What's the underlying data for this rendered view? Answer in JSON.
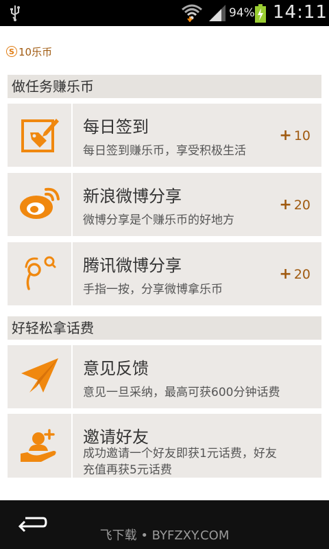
{
  "status_bar": {
    "battery_percent": "94%",
    "time": "14:11"
  },
  "balance": {
    "coin_symbol": "S",
    "text": "10乐币"
  },
  "sections": [
    {
      "title": "做任务赚乐币",
      "items": [
        {
          "title": "每日签到",
          "description": "每日签到赚乐币，享受积极生活",
          "reward": "10",
          "icon": "sign-in-edit-icon"
        },
        {
          "title": "新浪微博分享",
          "description": "微博分享是个赚乐币的好地方",
          "reward": "20",
          "icon": "sina-weibo-icon"
        },
        {
          "title": "腾讯微博分享",
          "description": "手指一按，分享微博拿乐币",
          "reward": "20",
          "icon": "tencent-weibo-icon"
        }
      ]
    },
    {
      "title": "好轻松拿话费",
      "items": [
        {
          "title": "意见反馈",
          "description": "意见一旦采纳，最高可获600分钟话费",
          "icon": "paper-plane-icon"
        },
        {
          "title": "邀请好友",
          "description_line1": "成功邀请一个好友即获1元话费，好友",
          "description_line2": "充值再获5元话费",
          "icon": "invite-friend-icon"
        }
      ]
    }
  ],
  "nav_bar": {
    "watermark": "飞下载 • BYFZXY.COM"
  },
  "colors": {
    "accent": "#f0880f",
    "reward_text": "#a05a10",
    "row_bg": "#ece9e6"
  }
}
